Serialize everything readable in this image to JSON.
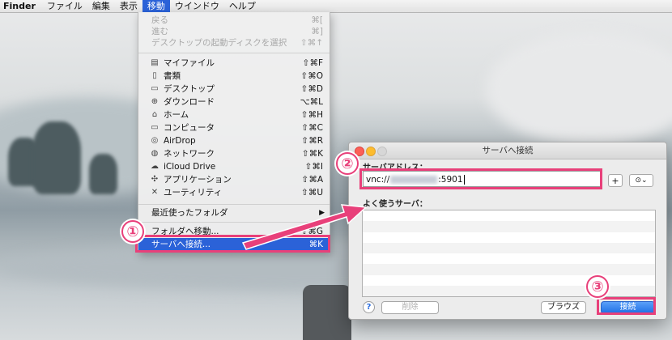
{
  "menubar": {
    "app": "Finder",
    "items": [
      "ファイル",
      "編集",
      "表示",
      "移動",
      "ウインドウ",
      "ヘルプ"
    ],
    "active_index": 3
  },
  "go_menu": {
    "nav": [
      {
        "label": "戻る",
        "shortcut": "⌘["
      },
      {
        "label": "進む",
        "shortcut": "⌘]"
      },
      {
        "label": "デスクトップの起動ディスクを選択",
        "shortcut": "⇧⌘↑"
      }
    ],
    "places": [
      {
        "label": "マイファイル",
        "shortcut": "⇧⌘F",
        "icon": "my-files-icon"
      },
      {
        "label": "書類",
        "shortcut": "⇧⌘O",
        "icon": "documents-icon"
      },
      {
        "label": "デスクトップ",
        "shortcut": "⇧⌘D",
        "icon": "desktop-icon"
      },
      {
        "label": "ダウンロード",
        "shortcut": "⌥⌘L",
        "icon": "downloads-icon"
      },
      {
        "label": "ホーム",
        "shortcut": "⇧⌘H",
        "icon": "home-icon"
      },
      {
        "label": "コンピュータ",
        "shortcut": "⇧⌘C",
        "icon": "computer-icon"
      },
      {
        "label": "AirDrop",
        "shortcut": "⇧⌘R",
        "icon": "airdrop-icon"
      },
      {
        "label": "ネットワーク",
        "shortcut": "⇧⌘K",
        "icon": "network-icon"
      },
      {
        "label": "iCloud Drive",
        "shortcut": "⇧⌘I",
        "icon": "icloud-icon"
      },
      {
        "label": "アプリケーション",
        "shortcut": "⇧⌘A",
        "icon": "applications-icon"
      },
      {
        "label": "ユーティリティ",
        "shortcut": "⇧⌘U",
        "icon": "utilities-icon"
      }
    ],
    "recent": {
      "label": "最近使ったフォルダ"
    },
    "goto_folder": {
      "label": "フォルダへ移動...",
      "shortcut": "⇧⌘G"
    },
    "connect": {
      "label": "サーバへ接続...",
      "shortcut": "⌘K"
    }
  },
  "dialog": {
    "title": "サーバへ接続",
    "address_label": "サーバアドレス：",
    "address_prefix": "vnc://",
    "address_suffix": ":5901",
    "add_button": "+",
    "history_button": "⊙⌄",
    "favorites_label": "よく使うサーバ：",
    "delete_button": "削除",
    "browse_button": "ブラウズ",
    "connect_button": "接続",
    "help": "?"
  },
  "annotations": {
    "step1": "①",
    "step2": "②",
    "step3": "③"
  },
  "colors": {
    "accent": "#2b62d8",
    "annotation": "#e8407a"
  }
}
